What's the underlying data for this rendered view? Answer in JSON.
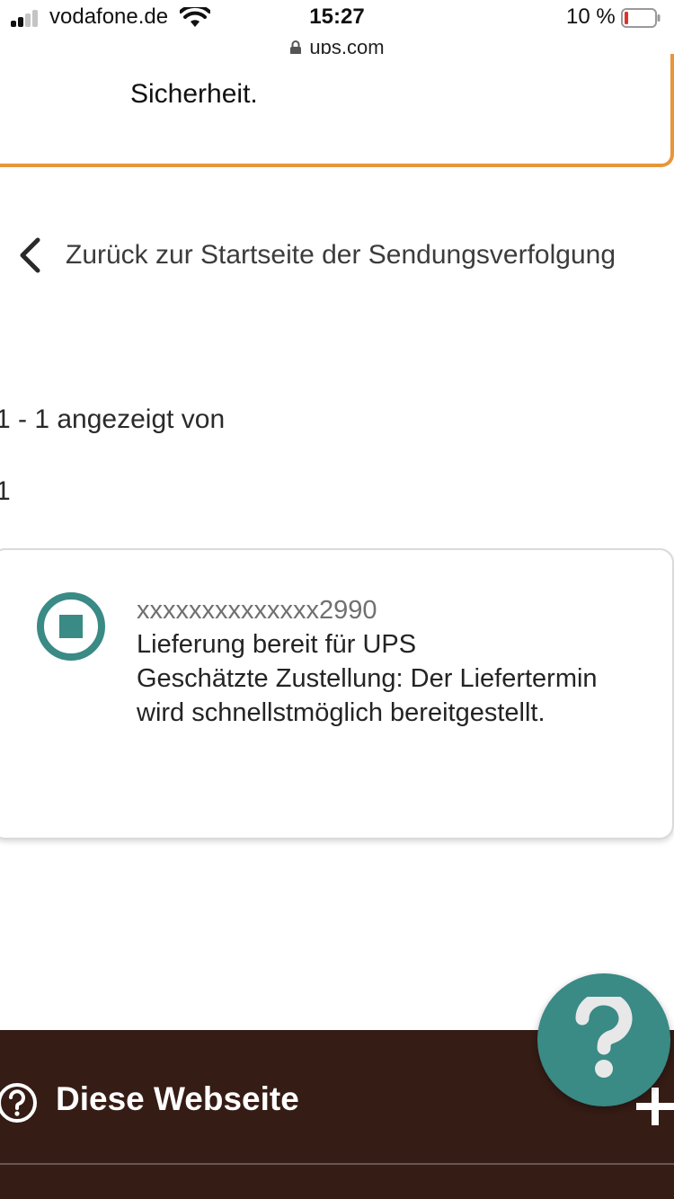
{
  "status_bar": {
    "carrier": "vodafone.de",
    "time": "15:27",
    "battery": "10 %",
    "battery_level": 0.1,
    "url": "ups.com"
  },
  "top_card": {
    "text": "Sicherheit.",
    "accent_color": "#e8963c"
  },
  "back_link": {
    "label": "Zurück zur Startseite der Sendungsverfolgung"
  },
  "results": {
    "count_text": "1 - 1 angezeigt von",
    "count_total": "1"
  },
  "shipment": {
    "tracking_number": "xxxxxxxxxxxxxx2990",
    "status": "Lieferung bereit für UPS",
    "estimate": "Geschätzte Zustellung: Der Liefertermin wird schnellstmöglich bereitgestellt.",
    "status_color": "#3a8a85"
  },
  "help": {
    "icon": "question-icon",
    "color": "#3a8a85"
  },
  "footer": {
    "title": "Diese Webseite",
    "background": "#351c15"
  }
}
